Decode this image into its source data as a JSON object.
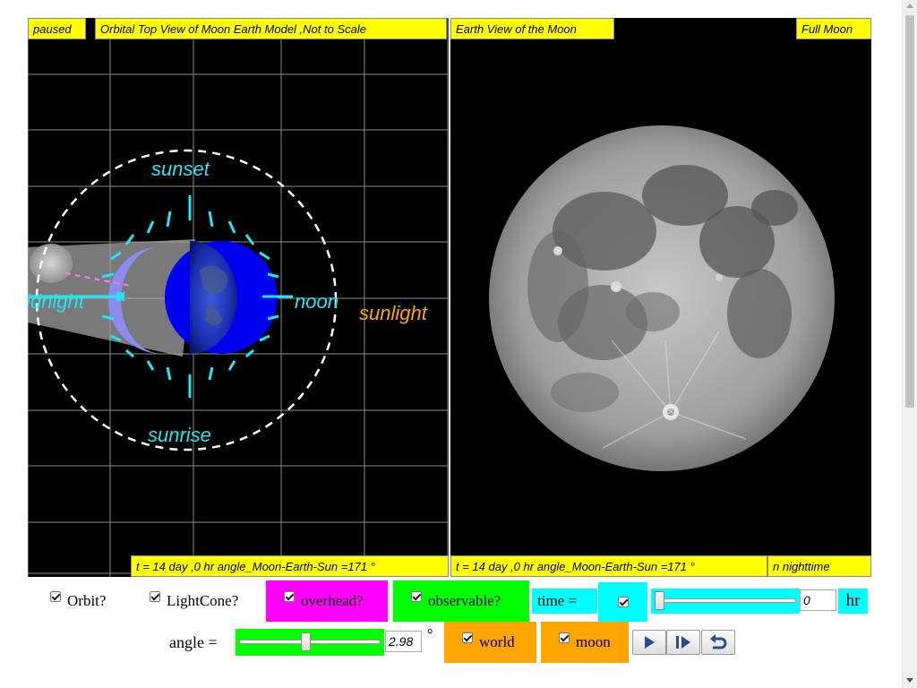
{
  "left_panel": {
    "status": "paused",
    "title": "Orbital Top View of Moon Earth Model ,Not to Scale",
    "footer": "t = 14 day ,0 hr angle_Moon-Earth-Sun =171 °",
    "labels": {
      "sunset": "sunset",
      "midnight": "idnight",
      "noon": "noon",
      "sunrise": "sunrise",
      "sunlight": "sunlight"
    }
  },
  "right_panel": {
    "title": "Earth View of the Moon",
    "phase": "Full Moon",
    "footer": "t = 14 day ,0 hr angle_Moon-Earth-Sun =171 °",
    "footer_right": "n nighttime"
  },
  "controls": {
    "orbit_label": "Orbit?",
    "lightcone_label": "LightCone?",
    "overhead_label": "overhead?",
    "observable_label": "observable?",
    "time_label": "time =",
    "time_value": "0",
    "time_unit": "hr",
    "time_slider_fraction": 0.0,
    "angle_label": "angle =",
    "angle_value": "2.98",
    "angle_unit": "°",
    "angle_slider_fraction": 0.47,
    "world_label": "world",
    "moon_label": "moon"
  },
  "colors": {
    "label_yellow": "#ffff00",
    "overhead_magenta": "#ff00ff",
    "observable_green": "#00ff00",
    "time_cyan": "#00ffff",
    "world_orange": "#ffa500",
    "label_cyan": "#22e6f0",
    "sunlight_orange": "#ffa500"
  },
  "icons": [
    "play-icon",
    "step-forward-icon",
    "reset-icon"
  ]
}
